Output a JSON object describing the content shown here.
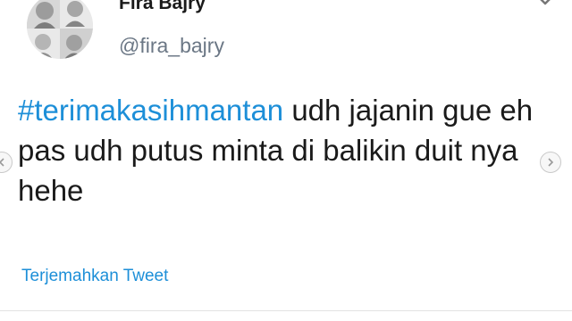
{
  "tweet": {
    "display_name": "Fira Bajry",
    "handle": "@fira_bajry",
    "hashtag": "#terimakasihmantan",
    "body_text": " udh jajanin gue eh pas udh putus minta di balikin duit nya hehe",
    "translate_label": "Terjemahkan Tweet",
    "avatar_icon": "profile-photo-icon",
    "menu_icon": "chevron-down-icon"
  },
  "carousel": {
    "prev_icon": "chevron-left-icon",
    "next_icon": "chevron-right-icon"
  },
  "colors": {
    "link": "#1d8fd8",
    "text": "#1a1a1a",
    "muted": "#6b7785"
  }
}
